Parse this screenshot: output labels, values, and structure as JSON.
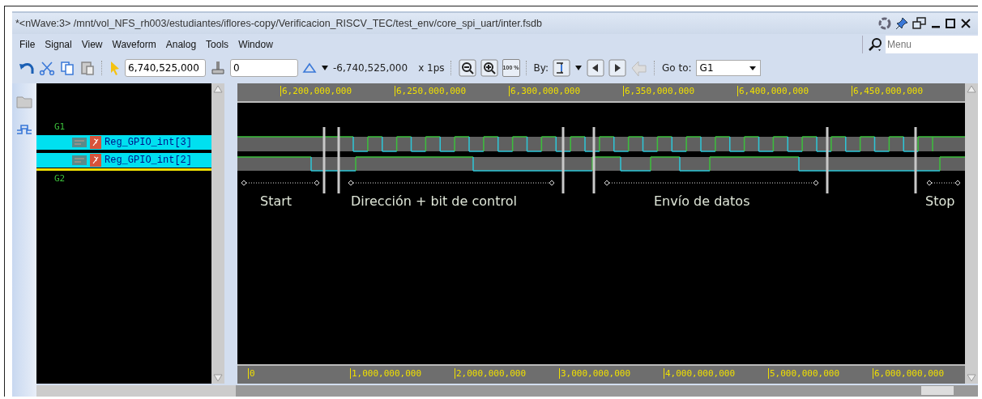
{
  "window": {
    "title": "*<nWave:3> /mnt/vol_NFS_rh003/estudiantes/iflores-copy/Verificacion_RISCV_TEC/test_env/core_spi_uart/inter.fsdb"
  },
  "menu": [
    "File",
    "Signal",
    "View",
    "Waveform",
    "Analog",
    "Tools",
    "Window"
  ],
  "search": {
    "placeholder": "Menu"
  },
  "toolbar": {
    "cursor_time": "6,740,525,000",
    "marker_time": "0",
    "delta": "-6,740,525,000",
    "unit": "x 1ps",
    "fit_label": "100 %",
    "by_label": "By:",
    "goto_label": "Go to:",
    "goto_value": "G1"
  },
  "signals": [
    {
      "group": "G1",
      "children": [
        {
          "name": "Reg_GPIO_int[3]",
          "selected": true
        },
        {
          "name": "Reg_GPIO_int[2]",
          "selected": true
        }
      ]
    },
    {
      "group": "G2"
    }
  ],
  "top_ruler": [
    "6,200,000,000",
    "6,250,000,000",
    "6,300,000,000",
    "6,350,000,000",
    "6,400,000,000",
    "6,450,000,000"
  ],
  "bottom_ruler": [
    "0",
    "1,000,000,000",
    "2,000,000,000",
    "3,000,000,000",
    "4,000,000,000",
    "5,000,000,000",
    "6,000,000,000"
  ],
  "annotations": [
    {
      "label": "Start"
    },
    {
      "label": "Dirección + bit de control"
    },
    {
      "label": "Envío de datos"
    },
    {
      "label": "Stop"
    }
  ]
}
